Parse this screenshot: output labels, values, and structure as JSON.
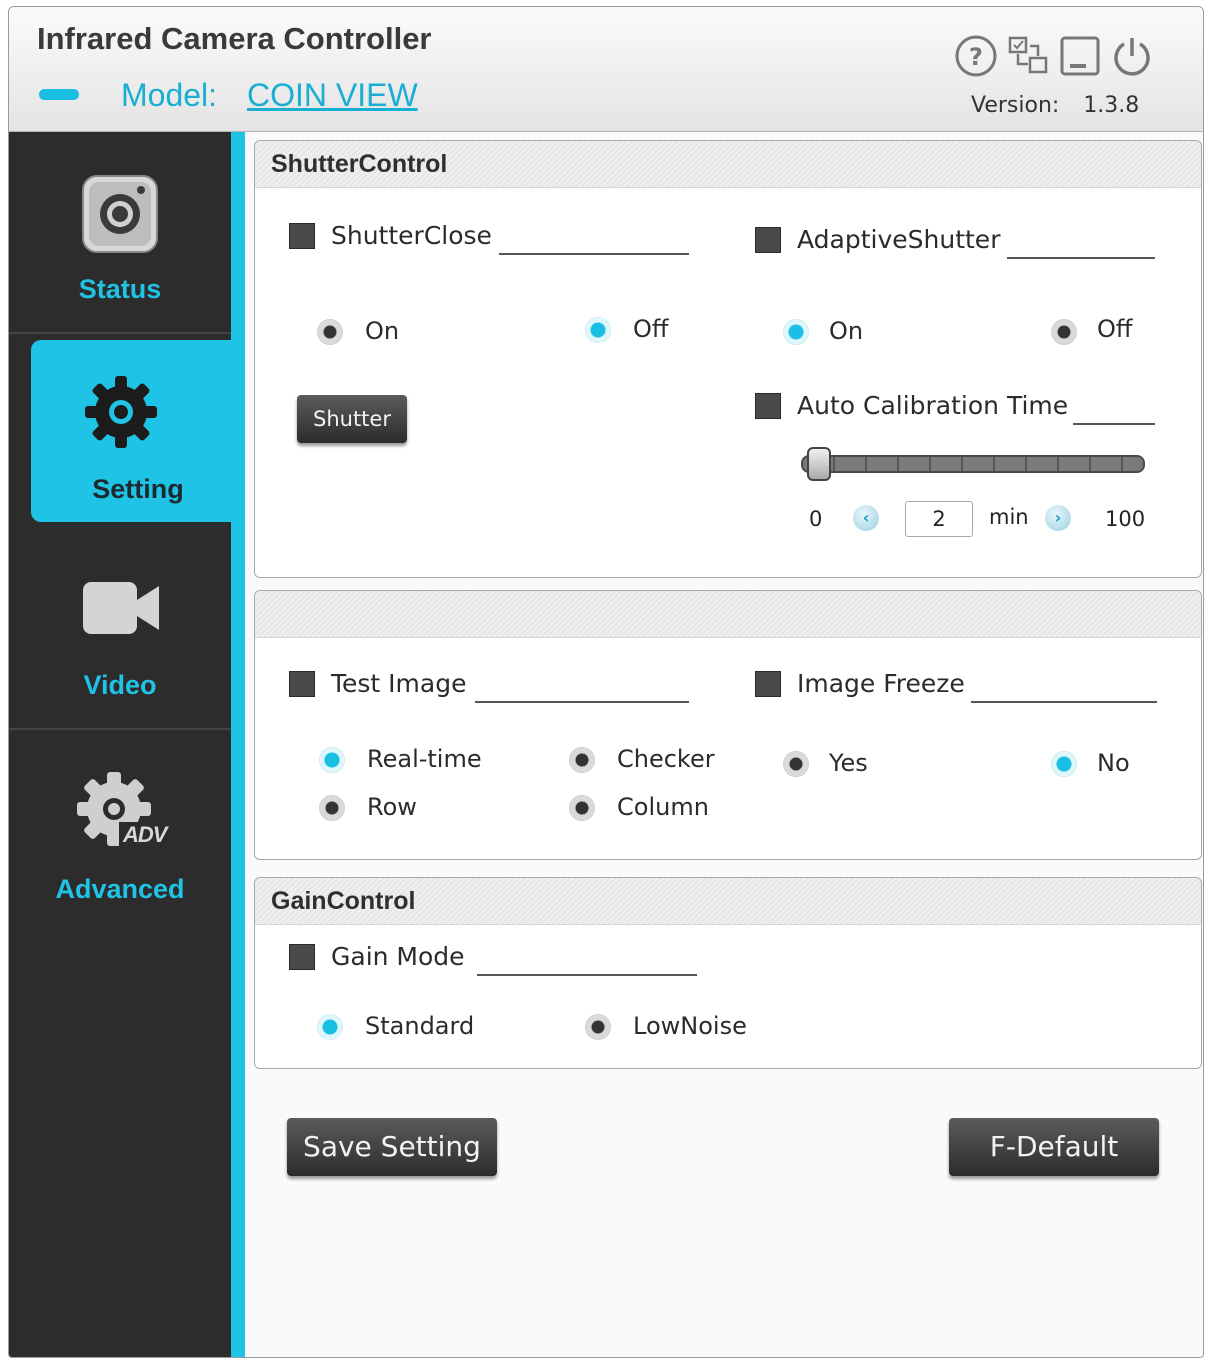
{
  "header": {
    "app_title": "Infrared Camera Controller",
    "model_label": "Model:",
    "model_value": "COIN VIEW",
    "version_label": "Version:",
    "version_value": "1.3.8",
    "icons": [
      "help-icon",
      "connection-icon",
      "minimize-icon",
      "power-icon"
    ]
  },
  "sidebar": {
    "items": [
      {
        "label": "Status",
        "icon": "camera-icon"
      },
      {
        "label": "Setting",
        "icon": "gear-icon",
        "active": true
      },
      {
        "label": "Video",
        "icon": "video-camera-icon"
      },
      {
        "label": "Advanced",
        "icon": "advanced-gear-icon",
        "icon_badge": "ADV"
      }
    ]
  },
  "shutter_control": {
    "title": "ShutterControl",
    "shutter_close": {
      "label": "ShutterClose",
      "on": "On",
      "off": "Off",
      "selected": "Off"
    },
    "shutter_button": "Shutter",
    "adaptive_shutter": {
      "label": "AdaptiveShutter",
      "on": "On",
      "off": "Off",
      "selected": "On"
    },
    "auto_calibration": {
      "label": "Auto Calibration Time",
      "min": "0",
      "max": "100",
      "value": "2",
      "unit": "min",
      "slider_value": 2
    }
  },
  "test_panel": {
    "title": "",
    "test_image": {
      "label": "Test Image",
      "options": [
        "Real-time",
        "Checker",
        "Row",
        "Column"
      ],
      "selected": "Real-time"
    },
    "image_freeze": {
      "label": "Image Freeze",
      "yes": "Yes",
      "no": "No",
      "selected": "No"
    }
  },
  "gain_control": {
    "title": "GainControl",
    "gain_mode": {
      "label": "Gain Mode",
      "standard": "Standard",
      "low_noise": "LowNoise",
      "selected": "Standard"
    }
  },
  "actions": {
    "save": "Save Setting",
    "default": "F-Default"
  },
  "colors": {
    "accent": "#1fc3e6",
    "sidebar_bg": "#2c2c2c",
    "button_dark": "#2c2c2c"
  }
}
